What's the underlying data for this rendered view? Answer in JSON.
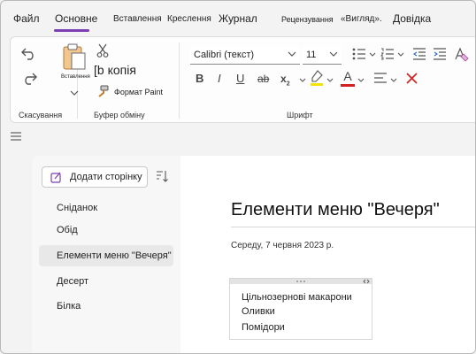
{
  "menu": {
    "tabs": [
      {
        "label": "Файл"
      },
      {
        "label": "Основне"
      },
      {
        "label": "Вставлення"
      },
      {
        "label": "Креслення"
      },
      {
        "label": "Журнал"
      },
      {
        "label": "Рецензування"
      },
      {
        "label": "«Вигляд»."
      },
      {
        "label": "Довідка"
      }
    ],
    "active_index": 1,
    "accent_color": "#7a3fb2"
  },
  "ribbon": {
    "undo": {
      "group_label": "Скасування"
    },
    "clipboard": {
      "paste_label": "Вставлення",
      "copy_label": "[b копія",
      "format_paint_label": "Формат Paint",
      "group_label": "Буфер обміну"
    },
    "font": {
      "font_name": "Calibri (текст)",
      "font_size": "11",
      "bold": "B",
      "italic": "I",
      "underline": "U",
      "strike": "ab",
      "subscript": "x",
      "subscript_mark": "2",
      "font_color_letter": "A",
      "highlight_color": "#f4e200",
      "font_color": "#d21f1f",
      "group_label": "Шрифт"
    }
  },
  "sidebar": {
    "add_page_label": "Додати сторінку",
    "pages": [
      {
        "label": "Сніданок"
      },
      {
        "label": "Обід"
      },
      {
        "label": "Елементи меню \"Вечеря\""
      },
      {
        "label": "Десерт"
      },
      {
        "label": "Білка"
      }
    ],
    "selected_index": 2
  },
  "page": {
    "title": "Елементи меню \"Вечеря\"",
    "date": "Середу, 7 червня 2023 р.",
    "note_lines": [
      "Цільнозернові макарони",
      "Оливки",
      "Помідори"
    ]
  }
}
